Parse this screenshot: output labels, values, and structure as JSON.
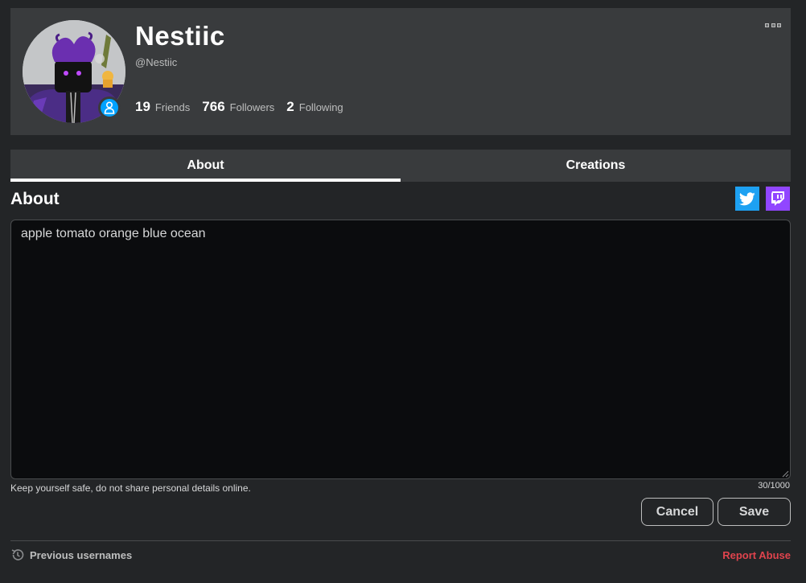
{
  "profile": {
    "display_name": "Nestiic",
    "username": "@Nestiic",
    "stats": [
      {
        "count": "19",
        "label": "Friends"
      },
      {
        "count": "766",
        "label": "Followers"
      },
      {
        "count": "2",
        "label": "Following"
      }
    ],
    "avatar_icon": "avatar-image",
    "presence_icon": "person-icon",
    "more_icon": "more-options-icon"
  },
  "tabs": [
    {
      "label": "About",
      "active": true
    },
    {
      "label": "Creations",
      "active": false
    }
  ],
  "about": {
    "title": "About",
    "social_links": [
      {
        "icon": "twitter-icon",
        "color": "#1da1f2"
      },
      {
        "icon": "twitch-icon",
        "color": "#9146ff"
      }
    ],
    "bio_value": "apple tomato orange blue ocean",
    "safety_note": "Keep yourself safe, do not share personal details online.",
    "char_count": "30/1000",
    "cancel_label": "Cancel",
    "save_label": "Save"
  },
  "footer": {
    "previous_usernames": "Previous usernames",
    "report_abuse": "Report Abuse"
  },
  "colors": {
    "background": "#232527",
    "card": "#393b3d",
    "accent_blue": "#00a2ff",
    "report_red": "#e0434d"
  }
}
